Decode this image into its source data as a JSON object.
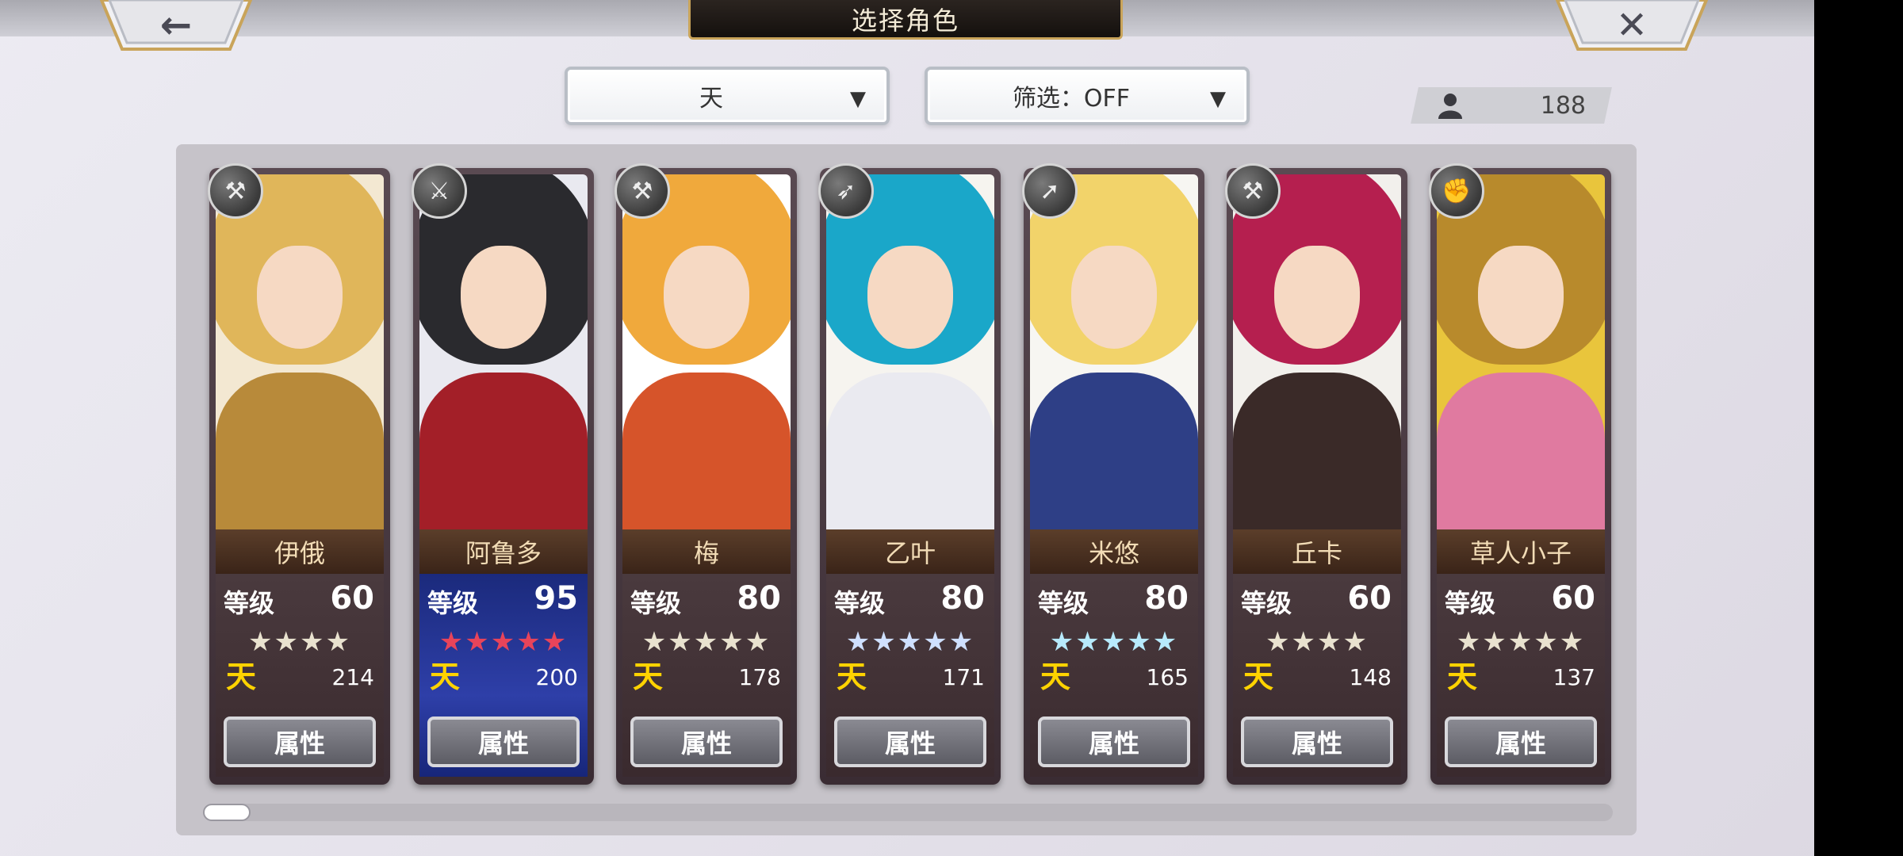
{
  "header": {
    "title": "选择角色",
    "back_glyph": "←",
    "close_glyph": "✕"
  },
  "filters": {
    "rarity": {
      "value": "天",
      "caret": "▼"
    },
    "filter": {
      "value": "筛选：OFF",
      "caret": "▼"
    }
  },
  "roster": {
    "icon": "person-icon",
    "count": "188"
  },
  "characters": [
    {
      "name": "伊俄",
      "level_label": "等级",
      "level": "60",
      "stars": "★★★★",
      "rank": "天",
      "power": "214",
      "attr_label": "属性",
      "weapon_icon": "axe-icon",
      "weapon_glyph": "⚒",
      "star_color": "white"
    },
    {
      "name": "阿鲁多",
      "level_label": "等级",
      "level": "95",
      "stars": "★★★★★",
      "rank": "天",
      "power": "200",
      "attr_label": "属性",
      "weapon_icon": "sword-icon",
      "weapon_glyph": "⚔",
      "star_color": "red"
    },
    {
      "name": "梅",
      "level_label": "等级",
      "level": "80",
      "stars": "★★★★★",
      "rank": "天",
      "power": "178",
      "attr_label": "属性",
      "weapon_icon": "hammer-icon",
      "weapon_glyph": "⚒",
      "star_color": "white"
    },
    {
      "name": "乙叶",
      "level_label": "等级",
      "level": "80",
      "stars": "★★★★★",
      "rank": "天",
      "power": "171",
      "attr_label": "属性",
      "weapon_icon": "bow-icon",
      "weapon_glyph": "➶",
      "star_color": "lightblue"
    },
    {
      "name": "米悠",
      "level_label": "等级",
      "level": "80",
      "stars": "★★★★★",
      "rank": "天",
      "power": "165",
      "attr_label": "属性",
      "weapon_icon": "spear-icon",
      "weapon_glyph": "➚",
      "star_color": "cyan"
    },
    {
      "name": "丘卡",
      "level_label": "等级",
      "level": "60",
      "stars": "★★★★",
      "rank": "天",
      "power": "148",
      "attr_label": "属性",
      "weapon_icon": "axe-icon",
      "weapon_glyph": "⚒",
      "star_color": "white"
    },
    {
      "name": "草人小子",
      "level_label": "等级",
      "level": "60",
      "stars": "★★★★★",
      "rank": "天",
      "power": "137",
      "attr_label": "属性",
      "weapon_icon": "fist-icon",
      "weapon_glyph": "✊",
      "star_color": "white"
    }
  ],
  "palette": {
    "portraits": [
      {
        "bg": "#f3e8d2",
        "hair": "#e0b65a",
        "body": "#b88a3a"
      },
      {
        "bg": "#e9e9f0",
        "hair": "#2a2a2e",
        "body": "#a31f28"
      },
      {
        "bg": "#ffffff",
        "hair": "#f0a93c",
        "body": "#d6542a"
      },
      {
        "bg": "#f6f4ef",
        "hair": "#1aa7c9",
        "body": "#eaeaf0"
      },
      {
        "bg": "#f7f6f2",
        "hair": "#f2d36a",
        "body": "#2e3f86"
      },
      {
        "bg": "#f2f0ec",
        "hair": "#b51f4f",
        "body": "#3a2a28"
      },
      {
        "bg": "#e9c53c",
        "hair": "#b88a2c",
        "body": "#e07aa0"
      }
    ]
  }
}
